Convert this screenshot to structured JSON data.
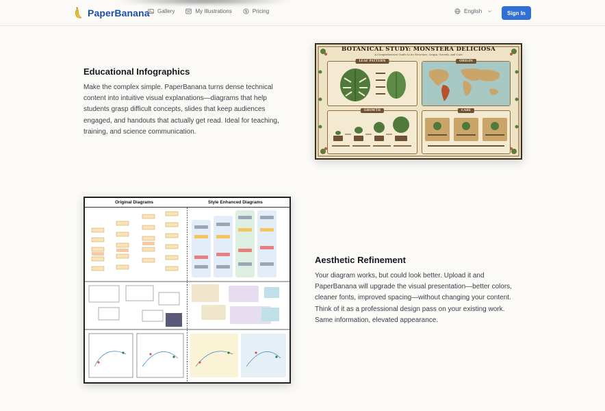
{
  "header": {
    "brand": "PaperBanana",
    "nav": [
      {
        "label": "Gallery",
        "icon": "image-icon"
      },
      {
        "label": "My Illustrations",
        "icon": "images-icon"
      },
      {
        "label": "Pricing",
        "icon": "coin-icon"
      }
    ],
    "language": "English",
    "signin_label": "Sign In"
  },
  "colors": {
    "brand": "#1d4ea8",
    "accent": "#2f6fd6",
    "background": "#fbfaf7"
  },
  "sections": [
    {
      "title": "Educational Infographics",
      "body": "Make the complex simple. PaperBanana turns dense technical content into intuitive visual explanations—diagrams that help students grasp difficult concepts, slides that keep audiences engaged, and handouts that actually get read. Ideal for teaching, training, and science communication.",
      "image": {
        "title": "BOTANICAL STUDY: MONSTERA DELICIOSA",
        "subtitle": "A Comprehensive Guide to its Structure, Origin, Growth, and Care",
        "panels": [
          "LEAF PATTERN",
          "ORIGIN",
          "GROWTH",
          "CARE"
        ]
      }
    },
    {
      "title": "Aesthetic Refinement",
      "body": "Your diagram works, but could look better. Upload it and PaperBanana will upgrade the visual presentation—better colors, cleaner fonts, improved spacing—without changing your content. Think of it as a professional design pass on your existing work. Same information, elevated appearance.",
      "image": {
        "left_heading": "Original Diagrams",
        "right_heading": "Style Enhanced Diagrams"
      }
    }
  ]
}
